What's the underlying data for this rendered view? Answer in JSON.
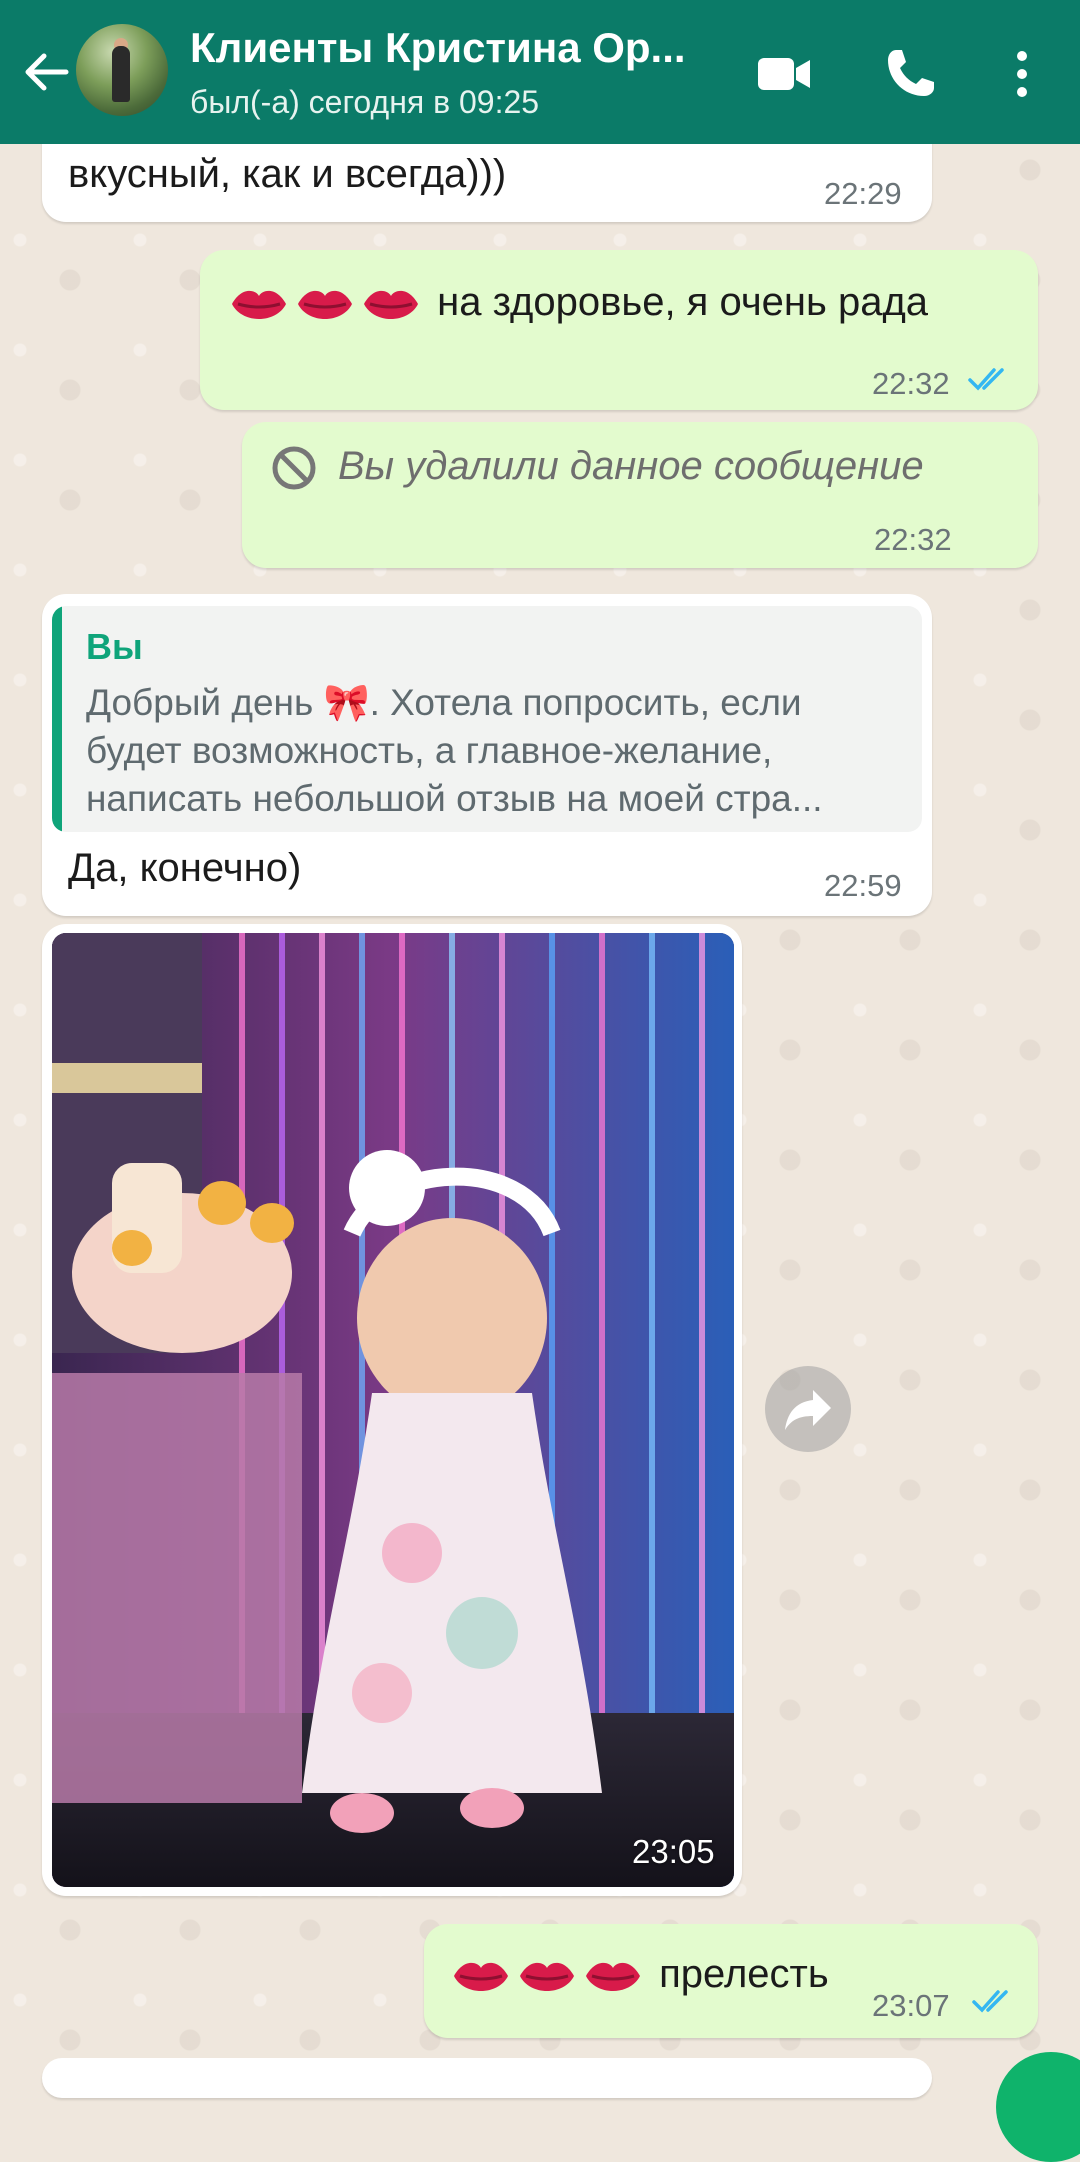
{
  "header": {
    "title": "Клиенты Кристина Ор...",
    "status": "был(-а) сегодня в 09:25"
  },
  "messages": [
    {
      "type": "in",
      "text": "вкусный, как и всегда)))",
      "time": "22:29"
    },
    {
      "type": "out",
      "text": "на здоровье,  я очень рада",
      "time": "22:32",
      "read": true
    },
    {
      "type": "out-deleted",
      "text": "Вы удалили данное сообщение",
      "time": "22:32"
    },
    {
      "type": "in-reply",
      "quote": {
        "author": "Вы",
        "lines": [
          "Добрый день 🎀.  Хотела попросить,  если",
          "будет возможность,  а главное-желание,",
          "написать небольшой отзыв на моей стра..."
        ]
      },
      "text": "Да, конечно)",
      "time": "22:59"
    },
    {
      "type": "in-image",
      "time": "23:05"
    },
    {
      "type": "out",
      "text": "прелесть",
      "time": "23:07",
      "read": true
    }
  ],
  "colors": {
    "header": "#0b7b68",
    "outgoing": "#e3fbce",
    "incoming": "#ffffff",
    "accent": "#0fa47a",
    "read_ticks": "#34b7f1",
    "kiss_emoji": "#d81b4a"
  },
  "icons": [
    "back-arrow-icon",
    "video-call-icon",
    "phone-icon",
    "more-vert-icon",
    "deleted-icon",
    "double-check-icon",
    "forward-icon",
    "kiss-icon"
  ]
}
